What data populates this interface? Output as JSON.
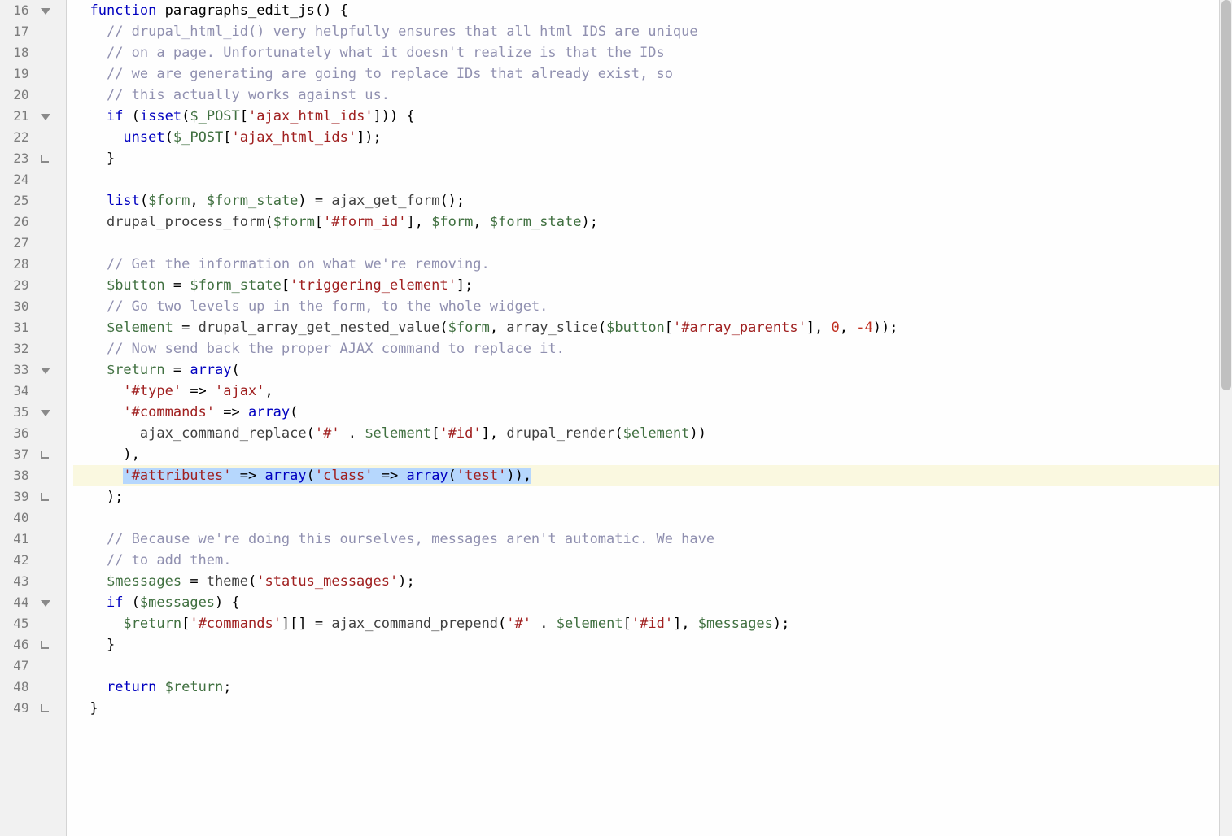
{
  "lines": [
    {
      "n": 16,
      "fold": "down"
    },
    {
      "n": 17
    },
    {
      "n": 18
    },
    {
      "n": 19
    },
    {
      "n": 20
    },
    {
      "n": 21,
      "fold": "down"
    },
    {
      "n": 22
    },
    {
      "n": 23,
      "fold": "end"
    },
    {
      "n": 24
    },
    {
      "n": 25
    },
    {
      "n": 26
    },
    {
      "n": 27
    },
    {
      "n": 28
    },
    {
      "n": 29
    },
    {
      "n": 30
    },
    {
      "n": 31
    },
    {
      "n": 32
    },
    {
      "n": 33,
      "fold": "down"
    },
    {
      "n": 34
    },
    {
      "n": 35,
      "fold": "down"
    },
    {
      "n": 36
    },
    {
      "n": 37,
      "fold": "end"
    },
    {
      "n": 38,
      "highlight": true
    },
    {
      "n": 39,
      "fold": "end"
    },
    {
      "n": 40
    },
    {
      "n": 41
    },
    {
      "n": 42
    },
    {
      "n": 43
    },
    {
      "n": 44,
      "fold": "down"
    },
    {
      "n": 45
    },
    {
      "n": 46,
      "fold": "end"
    },
    {
      "n": 47
    },
    {
      "n": 48
    },
    {
      "n": 49,
      "fold": "end"
    }
  ],
  "code": {
    "l16": {
      "indent": "  ",
      "kw_function": "function",
      "name": "paragraphs_edit_js",
      "tail": "() {"
    },
    "l17": {
      "indent": "    ",
      "text": "// drupal_html_id() very helpfully ensures that all html IDS are unique"
    },
    "l18": {
      "indent": "    ",
      "text": "// on a page. Unfortunately what it doesn't realize is that the IDs"
    },
    "l19": {
      "indent": "    ",
      "text": "// we are generating are going to replace IDs that already exist, so"
    },
    "l20": {
      "indent": "    ",
      "text": "// this actually works against us."
    },
    "l21": {
      "indent": "    ",
      "kw_if": "if",
      "open": " (",
      "fn_isset": "isset",
      "p1": "(",
      "var": "$_POST",
      "br": "[",
      "str": "'ajax_html_ids'",
      "close": "])) {"
    },
    "l22": {
      "indent": "      ",
      "fn_unset": "unset",
      "p1": "(",
      "var": "$_POST",
      "br": "[",
      "str": "'ajax_html_ids'",
      "close": "]);"
    },
    "l23": {
      "indent": "    ",
      "text": "}"
    },
    "l24": {
      "indent": ""
    },
    "l25": {
      "indent": "    ",
      "fn_list": "list",
      "p1": "(",
      "v1": "$form",
      "c1": ", ",
      "v2": "$form_state",
      "mid": ") = ",
      "call": "ajax_get_form",
      "tail": "();"
    },
    "l26": {
      "indent": "    ",
      "call": "drupal_process_form",
      "p1": "(",
      "v1": "$form",
      "br": "[",
      "str": "'#form_id'",
      "mid": "], ",
      "v2": "$form",
      "c2": ", ",
      "v3": "$form_state",
      "tail": ");"
    },
    "l27": {
      "indent": ""
    },
    "l28": {
      "indent": "    ",
      "text": "// Get the information on what we're removing."
    },
    "l29": {
      "indent": "    ",
      "v1": "$button",
      "eq": " = ",
      "v2": "$form_state",
      "br": "[",
      "str": "'triggering_element'",
      "tail": "];"
    },
    "l30": {
      "indent": "    ",
      "text": "// Go two levels up in the form, to the whole widget."
    },
    "l31": {
      "indent": "    ",
      "v1": "$element",
      "eq": " = ",
      "call1": "drupal_array_get_nested_value",
      "p1": "(",
      "v2": "$form",
      "c1": ", ",
      "call2": "array_slice",
      "p2": "(",
      "v3": "$button",
      "br": "[",
      "str": "'#array_parents'",
      "mid": "], ",
      "n1": "0",
      "c2": ", ",
      "n2": "-4",
      "tail": "));"
    },
    "l32": {
      "indent": "    ",
      "text": "// Now send back the proper AJAX command to replace it."
    },
    "l33": {
      "indent": "    ",
      "v1": "$return",
      "eq": " = ",
      "arr": "array",
      "tail": "("
    },
    "l34": {
      "indent": "      ",
      "k": "'#type'",
      "arrow": " => ",
      "v": "'ajax'",
      "tail": ","
    },
    "l35": {
      "indent": "      ",
      "k": "'#commands'",
      "arrow": " => ",
      "arr": "array",
      "tail": "("
    },
    "l36": {
      "indent": "        ",
      "call": "ajax_command_replace",
      "p1": "(",
      "s1": "'#'",
      "cat": " . ",
      "v1": "$element",
      "br": "[",
      "s2": "'#id'",
      "mid": "], ",
      "call2": "drupal_render",
      "p2": "(",
      "v2": "$element",
      "tail": "))"
    },
    "l37": {
      "indent": "      ",
      "text": "),"
    },
    "l38": {
      "indent": "      ",
      "k": "'#attributes'",
      "arrow": " => ",
      "arr1": "array",
      "p1": "(",
      "k2": "'class'",
      "arrow2": " => ",
      "arr2": "array",
      "p2": "(",
      "v": "'test'",
      "close": ")),",
      "trail": ""
    },
    "l39": {
      "indent": "    ",
      "text": ");"
    },
    "l40": {
      "indent": ""
    },
    "l41": {
      "indent": "    ",
      "text": "// Because we're doing this ourselves, messages aren't automatic. We have"
    },
    "l42": {
      "indent": "    ",
      "text": "// to add them."
    },
    "l43": {
      "indent": "    ",
      "v1": "$messages",
      "eq": " = ",
      "call": "theme",
      "p1": "(",
      "str": "'status_messages'",
      "tail": ");"
    },
    "l44": {
      "indent": "    ",
      "kw_if": "if",
      "p": " (",
      "v": "$messages",
      "tail": ") {"
    },
    "l45": {
      "indent": "      ",
      "v1": "$return",
      "br1": "[",
      "s1": "'#commands'",
      "mid1": "][] = ",
      "call": "ajax_command_prepend",
      "p1": "(",
      "s2": "'#'",
      "cat": " . ",
      "v2": "$element",
      "br2": "[",
      "s3": "'#id'",
      "mid2": "], ",
      "v3": "$messages",
      "tail": ");"
    },
    "l46": {
      "indent": "    ",
      "text": "}"
    },
    "l47": {
      "indent": ""
    },
    "l48": {
      "indent": "    ",
      "kw": "return",
      "sp": " ",
      "v": "$return",
      "tail": ";"
    },
    "l49": {
      "indent": "  ",
      "text": "}"
    }
  }
}
